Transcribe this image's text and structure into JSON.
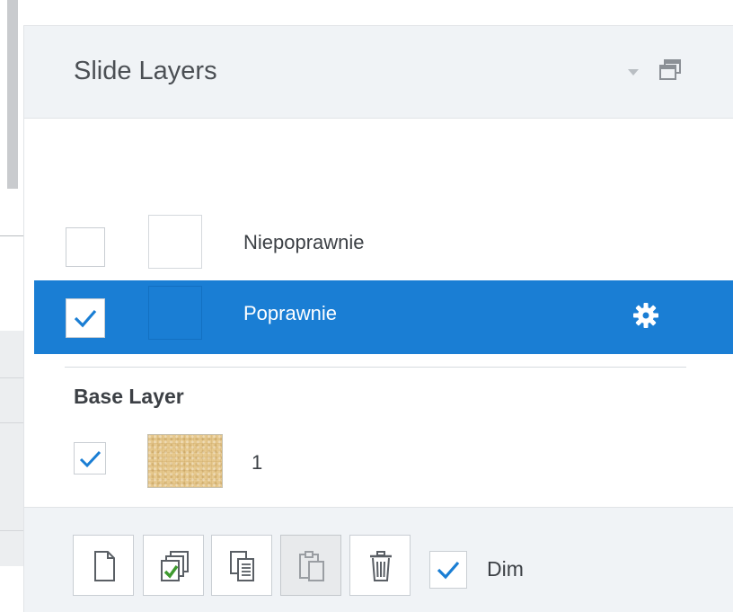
{
  "panel": {
    "title": "Slide Layers"
  },
  "layers": [
    {
      "label": "Niepoprawnie",
      "visible": false,
      "selected": false
    },
    {
      "label": "Poprawnie",
      "visible": true,
      "selected": true
    }
  ],
  "base_layer": {
    "title": "Base Layer",
    "label": "1",
    "visible": true
  },
  "toolbar": {
    "dim_label": "Dim",
    "dim_checked": true,
    "buttons": [
      "new-layer-icon",
      "duplicate-layer-icon",
      "copy-layer-icon",
      "paste-layer-icon",
      "trash-icon"
    ]
  },
  "colors": {
    "accent": "#1a7ed4",
    "panel_bg": "#f0f3f6",
    "text": "#3c4045",
    "check": "#1a7ed4"
  }
}
